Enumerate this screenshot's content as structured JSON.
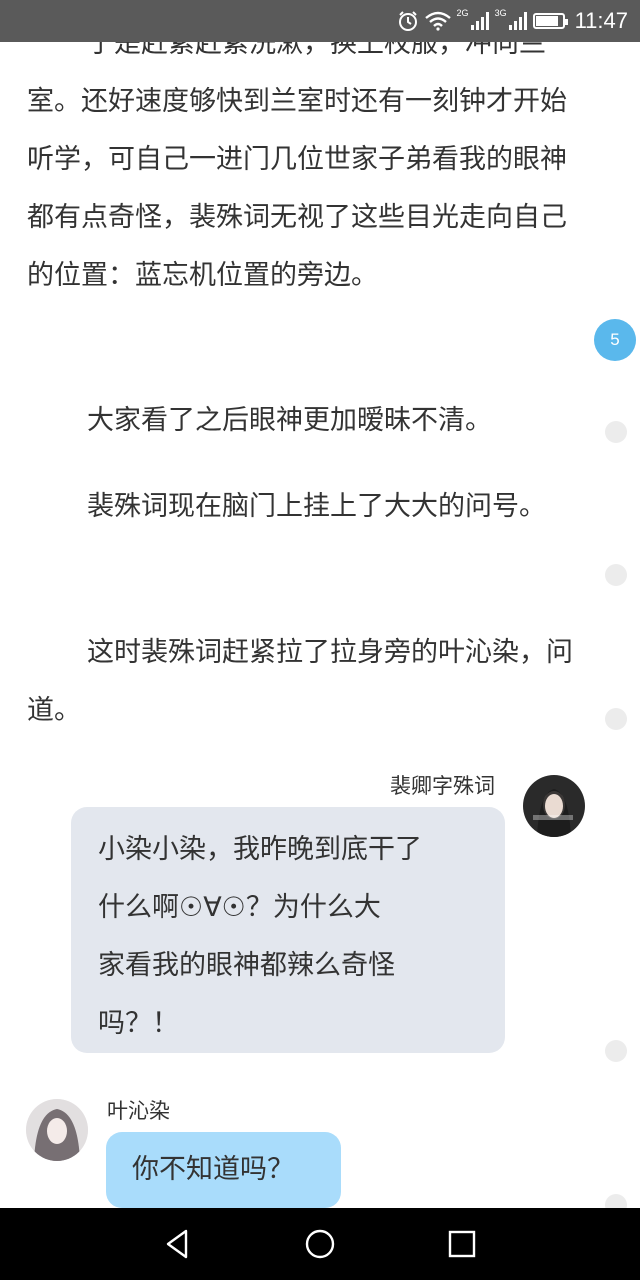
{
  "status_bar": {
    "net_left": "2G",
    "net_right": "3G",
    "time": "11:47",
    "battery_level": 0.8
  },
  "paragraphs": [
    "于是赶紧赶紧洗漱，换上校服，冲向兰室。还好速度够快到兰室时还有一刻钟才开始听学，可自己一进门几位世家子弟看我的眼神都有点奇怪，裴殊词无视了这些目光走向自己的位置：蓝忘机位置的旁边。",
    "大家看了之后眼神更加暧昧不清。",
    "裴殊词现在脑门上挂上了大大的问号。",
    "这时裴殊词赶紧拉了拉身旁的叶沁染，问道。"
  ],
  "comment_badge": "5",
  "chat": [
    {
      "side": "right",
      "speaker": "裴卿字殊词",
      "lines": [
        "小染小染，我昨晚到底干了",
        "什么啊☉∀☉？为什么大",
        "家看我的眼神都辣么奇怪",
        "吗？！"
      ]
    },
    {
      "side": "left",
      "speaker": "叶沁染",
      "lines": [
        "你不知道吗？"
      ]
    }
  ],
  "icons": {
    "alarm": "alarm-icon",
    "wifi": "wifi-icon",
    "signal": "signal-icon",
    "battery": "battery-icon",
    "back": "back-triangle-icon",
    "home": "home-circle-icon",
    "recent": "recent-square-icon"
  }
}
